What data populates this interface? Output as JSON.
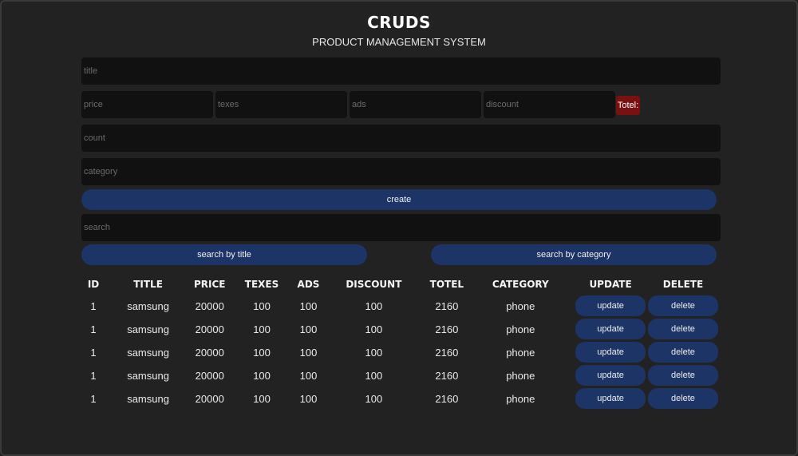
{
  "header": {
    "title": "CRUDS",
    "subtitle": "PRODUCT MANAGEMENT SYSTEM"
  },
  "form": {
    "title_placeholder": "title",
    "price_placeholder": "price",
    "taxes_placeholder": "texes",
    "ads_placeholder": "ads",
    "discount_placeholder": "discount",
    "total_label": "Totel:",
    "count_placeholder": "count",
    "category_placeholder": "category",
    "create_label": "create"
  },
  "search": {
    "placeholder": "search",
    "by_title_label": "search by title",
    "by_category_label": "search by category"
  },
  "table": {
    "headers": [
      "ID",
      "TITLE",
      "PRICE",
      "TEXES",
      "ADS",
      "DISCOUNT",
      "TOTEL",
      "CATEGORY",
      "UPDATE",
      "DELETE"
    ],
    "rows": [
      {
        "id": "1",
        "title": "samsung",
        "price": "20000",
        "taxes": "100",
        "ads": "100",
        "discount": "100",
        "total": "2160",
        "category": "phone",
        "update": "update",
        "delete": "delete"
      },
      {
        "id": "1",
        "title": "samsung",
        "price": "20000",
        "taxes": "100",
        "ads": "100",
        "discount": "100",
        "total": "2160",
        "category": "phone",
        "update": "update",
        "delete": "delete"
      },
      {
        "id": "1",
        "title": "samsung",
        "price": "20000",
        "taxes": "100",
        "ads": "100",
        "discount": "100",
        "total": "2160",
        "category": "phone",
        "update": "update",
        "delete": "delete"
      },
      {
        "id": "1",
        "title": "samsung",
        "price": "20000",
        "taxes": "100",
        "ads": "100",
        "discount": "100",
        "total": "2160",
        "category": "phone",
        "update": "update",
        "delete": "delete"
      },
      {
        "id": "1",
        "title": "samsung",
        "price": "20000",
        "taxes": "100",
        "ads": "100",
        "discount": "100",
        "total": "2160",
        "category": "phone",
        "update": "update",
        "delete": "delete"
      }
    ]
  },
  "colors": {
    "background": "#222222",
    "input_background": "#111111",
    "button": "#1c3466",
    "total_badge": "#7a1010"
  }
}
